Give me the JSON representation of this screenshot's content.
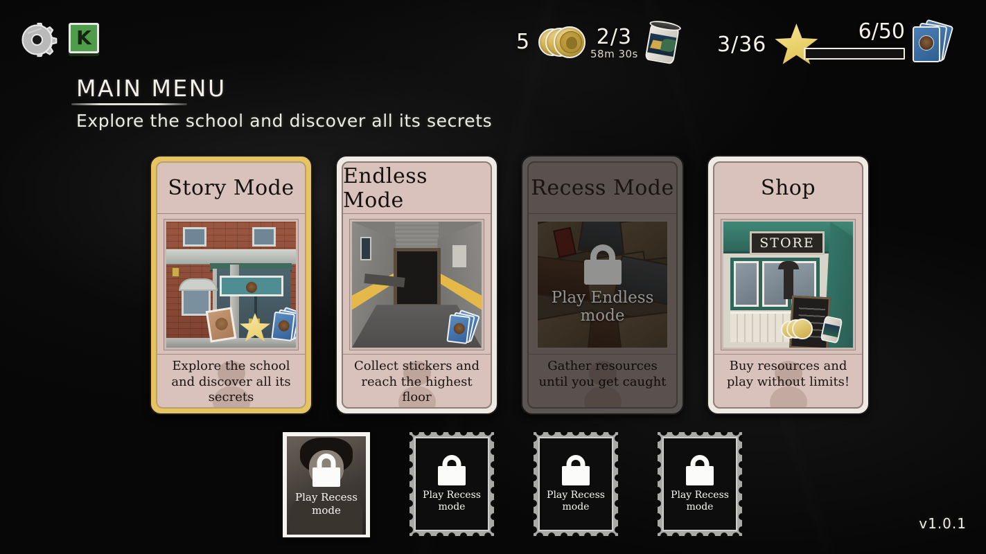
{
  "header": {
    "settings_icon": "gear-icon",
    "kongregate_icon_label": "K"
  },
  "status_bar": {
    "coins": {
      "value": "5",
      "icon": "coin-icon"
    },
    "cans": {
      "value": "2/3",
      "timer": "58m 30s",
      "icon": "can-icon"
    },
    "stars": {
      "value": "3/36",
      "icon": "star-icon"
    },
    "cards": {
      "value": "6/50",
      "icon": "card-deck-icon",
      "progress_percent": 12
    }
  },
  "page": {
    "title": "MAIN MENU",
    "subtitle": "Explore the school and discover all its secrets",
    "version": "v1.0.1"
  },
  "modes": [
    {
      "title": "Story Mode",
      "description": "Explore the school and discover all its secrets",
      "state": "selected",
      "locked": false,
      "art": "school-front",
      "lock_text": ""
    },
    {
      "title": "Endless Mode",
      "description": "Collect stickers and reach the highest floor",
      "state": "normal",
      "locked": false,
      "art": "hallway",
      "lock_text": ""
    },
    {
      "title": "Recess Mode",
      "description": "Gather resources until you get caught",
      "state": "locked",
      "locked": true,
      "art": "recess-clutter",
      "lock_text": "Play Endless mode"
    },
    {
      "title": "Shop",
      "description": "Buy resources and play without limits!",
      "state": "normal",
      "locked": false,
      "art": "store-front",
      "lock_text": ""
    }
  ],
  "stickers": [
    {
      "style": "polaroid",
      "lock_text": "Play Recess mode",
      "locked": true,
      "selected": true
    },
    {
      "style": "stamp",
      "lock_text": "Play Recess mode",
      "locked": true,
      "selected": false
    },
    {
      "style": "stamp",
      "lock_text": "Play Recess mode",
      "locked": true,
      "selected": false
    },
    {
      "style": "stamp",
      "lock_text": "Play Recess mode",
      "locked": true,
      "selected": false
    }
  ],
  "colors": {
    "background": "#070707",
    "card_face": "#d9c2bb",
    "selected_border": "#e7c463",
    "normal_border": "#efeae3",
    "locked_border": "#9d9490",
    "accent_yellow": "#e8d169",
    "chalk_white": "#f2f0e8"
  },
  "store_sign": "STORE"
}
